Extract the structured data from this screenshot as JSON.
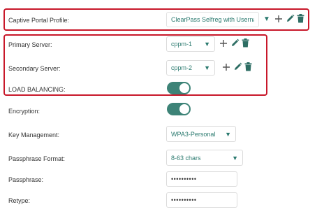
{
  "captive_portal": {
    "label": "Captive Portal Profile:",
    "value": "ClearPass Selfreg with Username"
  },
  "primary_server": {
    "label": "Primary Server:",
    "value": "cppm-1"
  },
  "secondary_server": {
    "label": "Secondary Server:",
    "value": "cppm-2"
  },
  "load_balancing": {
    "label": "LOAD BALANCING:",
    "enabled": true
  },
  "encryption": {
    "label": "Encryption:",
    "enabled": true
  },
  "key_management": {
    "label": "Key Management:",
    "value": "WPA3-Personal"
  },
  "passphrase_format": {
    "label": "Passphrase Format:",
    "value": "8-63 chars"
  },
  "passphrase": {
    "label": "Passphrase:",
    "value": "••••••••••"
  },
  "retype": {
    "label": "Retype:",
    "value": "••••••••••"
  },
  "icons": {
    "add": "plus-icon",
    "edit": "pencil-icon",
    "delete": "trash-icon",
    "dropdown": "caret-down-icon"
  },
  "colors": {
    "accent": "#2b7a6f",
    "toggle_on": "#3d8377",
    "highlight": "#c8182a"
  }
}
